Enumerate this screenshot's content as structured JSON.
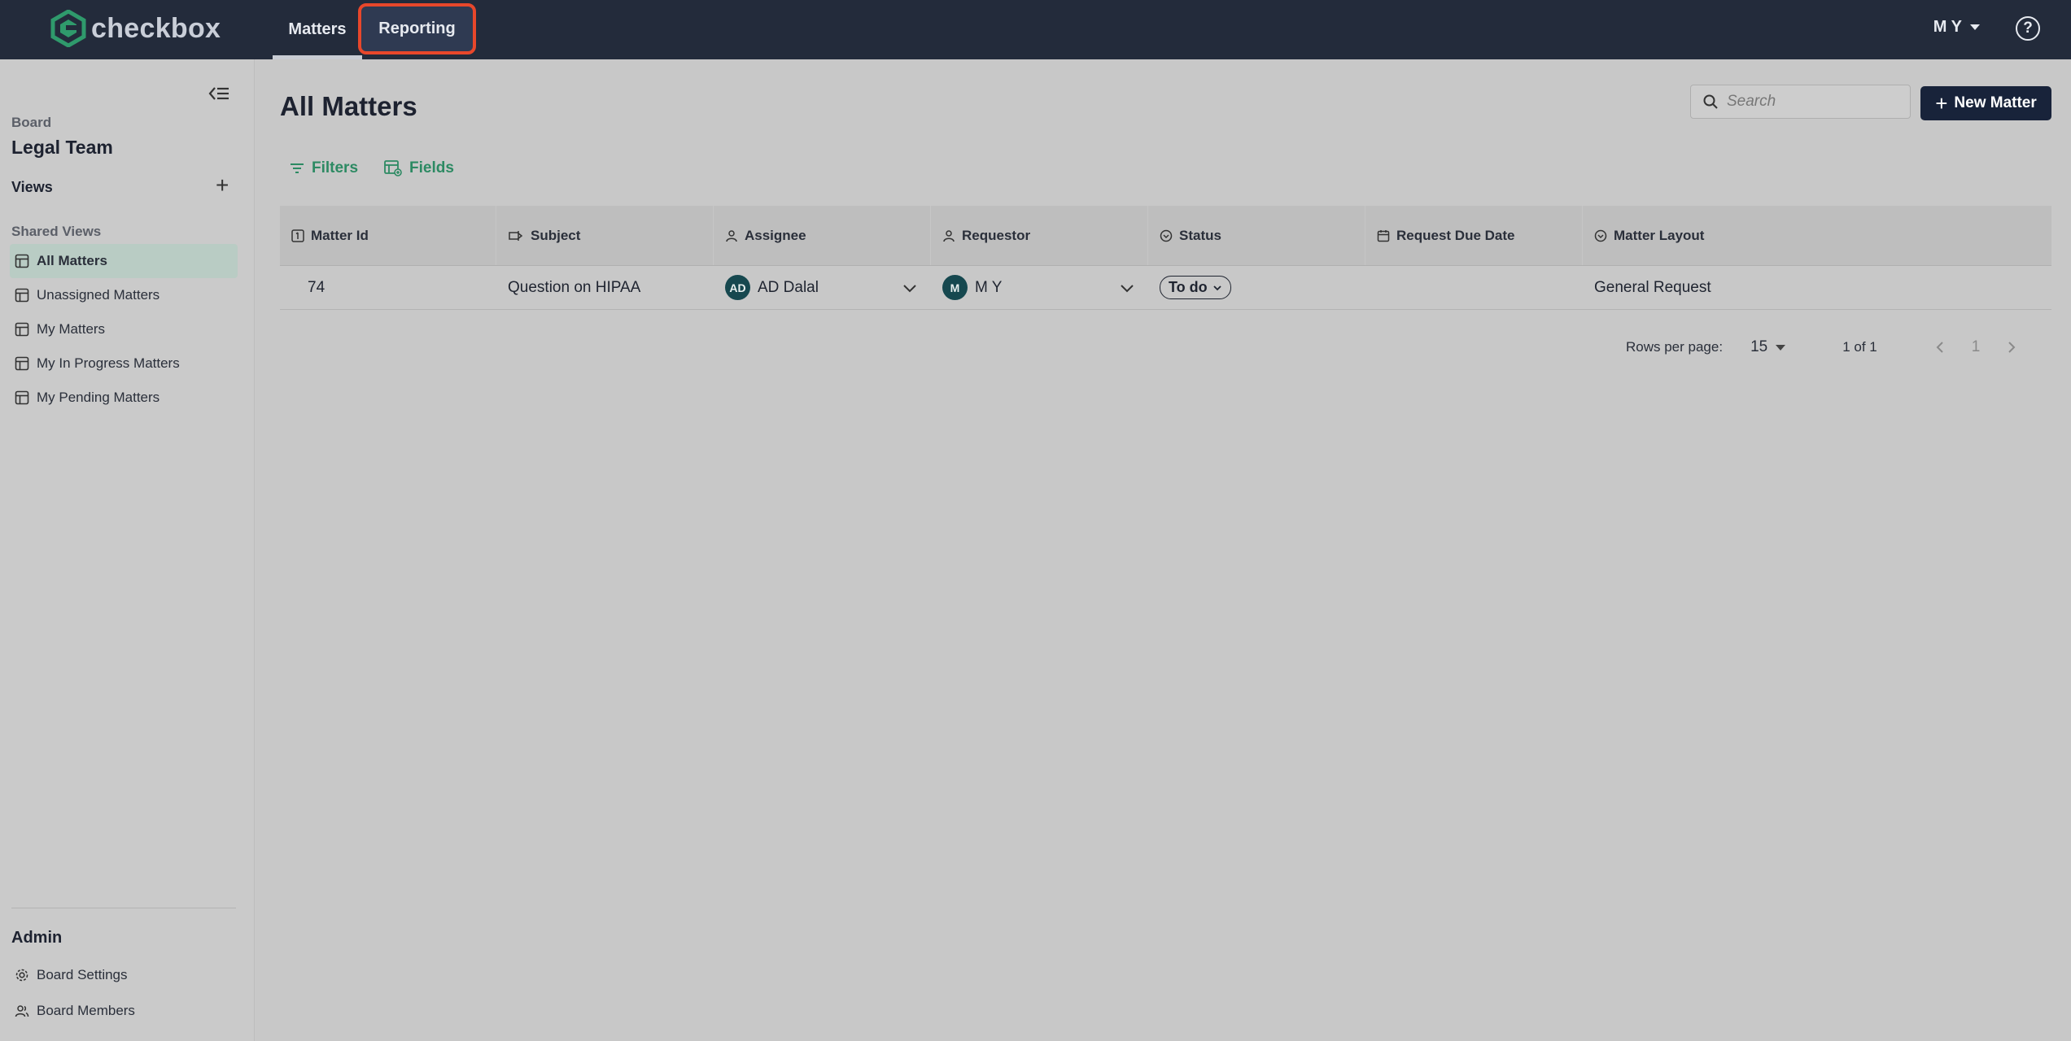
{
  "app": {
    "brand": "checkbox",
    "brand_color": "#2d8a63"
  },
  "topnav": {
    "tabs": [
      {
        "label": "Matters",
        "active": true
      },
      {
        "label": "Reporting",
        "highlighted": true
      }
    ],
    "user": "M Y",
    "help_icon": "question-circle-icon"
  },
  "sidebar": {
    "board_label": "Board",
    "board_name": "Legal Team",
    "views_label": "Views",
    "shared_views_label": "Shared Views",
    "views": [
      {
        "label": "All Matters",
        "active": true
      },
      {
        "label": "Unassigned Matters"
      },
      {
        "label": "My Matters"
      },
      {
        "label": "My In Progress Matters"
      },
      {
        "label": "My Pending Matters"
      }
    ],
    "admin_label": "Admin",
    "admin_items": [
      {
        "label": "Board Settings",
        "icon": "gear-icon"
      },
      {
        "label": "Board Members",
        "icon": "users-icon"
      }
    ]
  },
  "main": {
    "title": "All Matters",
    "search_placeholder": "Search",
    "new_matter_label": "New Matter",
    "filters_label": "Filters",
    "fields_label": "Fields",
    "columns": [
      "Matter Id",
      "Subject",
      "Assignee",
      "Requestor",
      "Status",
      "Request Due Date",
      "Matter Layout"
    ],
    "rows": [
      {
        "matter_id": "74",
        "subject": "Question on HIPAA",
        "assignee_initials": "AD",
        "assignee": "AD Dalal",
        "requestor_initials": "M",
        "requestor": "M Y",
        "status": "To do",
        "request_due_date": "",
        "matter_layout": "General Request"
      }
    ],
    "pagination": {
      "rows_per_page_label": "Rows per page:",
      "rows_per_page": "15",
      "page_info": "1 of 1",
      "current_page": "1"
    }
  }
}
